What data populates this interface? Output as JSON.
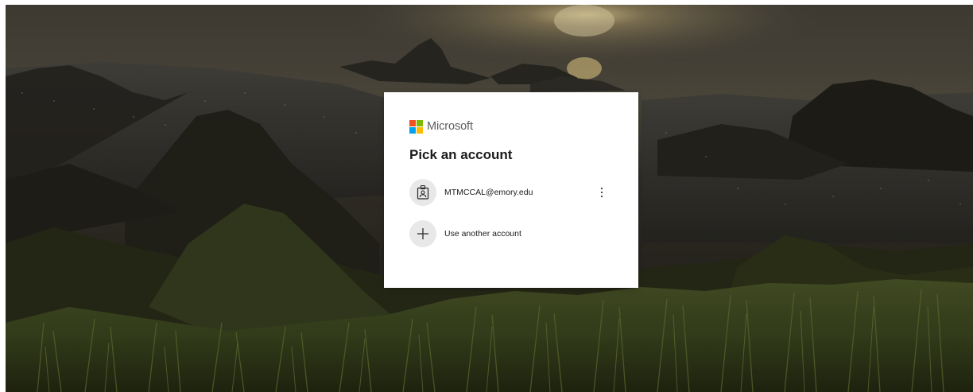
{
  "brand": {
    "name": "Microsoft",
    "logo_colors": [
      "#f25022",
      "#7fba00",
      "#00a4ef",
      "#ffb900"
    ]
  },
  "dialog": {
    "title": "Pick an account",
    "accounts": [
      {
        "email": "MTMCCAL@emory.edu",
        "icon": "badge-icon",
        "menu_icon": "more-vertical-icon"
      }
    ],
    "other_account": {
      "label": "Use another account",
      "icon": "plus-icon"
    }
  },
  "background": {
    "description_icon": "landscape-background",
    "overlay_color": "#000000"
  }
}
